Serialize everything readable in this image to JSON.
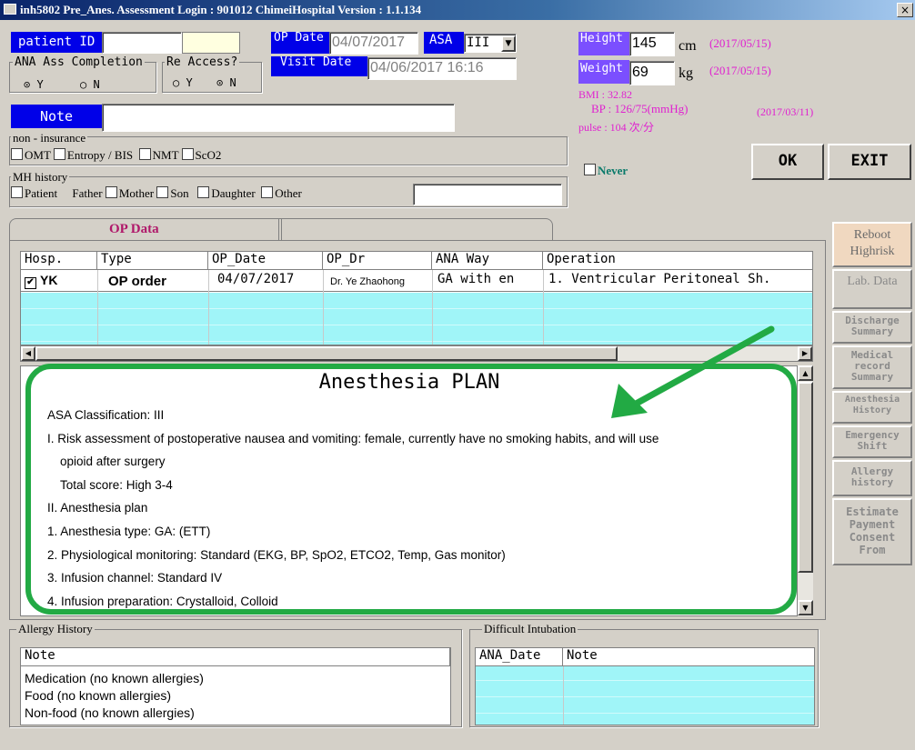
{
  "window": {
    "title": "inh5802 Pre_Anes. Assessment Login  : 901012 ChimeiHospital Version : 1.1.134",
    "close": "×"
  },
  "patient": {
    "id_label": "patient ID",
    "id_value": "",
    "note_label": "Note",
    "note_value": ""
  },
  "op": {
    "op_date_label": "OP Date",
    "op_date": "04/07/2017",
    "asa_label": "ASA",
    "asa_value": "III",
    "visit_date_label": "Visit Date",
    "visit_date": "04/06/2017 16:16"
  },
  "ana_completion": {
    "label": "ANA Ass Completion",
    "options": [
      "Y",
      "N"
    ],
    "selected": "Y"
  },
  "re_access": {
    "label": "Re Access?",
    "options": [
      "Y",
      "N"
    ],
    "selected": "N"
  },
  "vitals": {
    "height_label": "Height",
    "height": "145",
    "height_unit": "cm",
    "height_date": "(2017/05/15)",
    "weight_label": "Weight",
    "weight": "69",
    "weight_unit": "kg",
    "weight_date": "(2017/05/15)",
    "bmi": "BMI : 32.82",
    "bp": "BP : 126/75(mmHg)",
    "bp_date": "(2017/03/11)",
    "pulse": "pulse : 104 次/分"
  },
  "non_insurance": {
    "label": "non - insurance",
    "items": [
      "OMT",
      "Entropy / BIS",
      "NMT",
      "ScO2"
    ]
  },
  "mh_history": {
    "label": "MH history",
    "items": [
      "Patient",
      "Father",
      "Mother",
      "Son",
      "Daughter",
      "Other"
    ]
  },
  "never_label": "Never",
  "buttons": {
    "ok": "OK",
    "exit": "EXIT"
  },
  "tabs": {
    "op_data": "OP Data"
  },
  "op_table": {
    "headers": [
      "Hosp.",
      "Type",
      "OP_Date",
      "OP_Dr",
      "ANA Way",
      "Operation"
    ],
    "row": {
      "hosp": "YK",
      "type": "OP order",
      "date": "04/07/2017",
      "dr": "Dr. Ye Zhaohong",
      "ana": "GA with en",
      "operation": "1. Ventricular Peritoneal Sh."
    }
  },
  "side_buttons": [
    "Reboot Highrisk",
    "Lab. Data",
    "Discharge Summary",
    "Medical record Summary",
    "Anesthesia History",
    "Emergency Shift",
    "Allergy history",
    "Estimate Payment Consent From"
  ],
  "plan": {
    "title": "Anesthesia PLAN",
    "lines": [
      "ASA Classification: III",
      "I. Risk assessment of postoperative nausea and vomiting: female, currently have no smoking habits, and will use",
      "opioid after surgery",
      "Total score: High 3-4",
      "II. Anesthesia plan",
      "1. Anesthesia type: GA: (ETT)",
      "2. Physiological monitoring: Standard (EKG, BP, SpO2, ETCO2, Temp, Gas monitor)",
      "3. Infusion channel: Standard IV",
      "4. Infusion preparation: Crystalloid, Colloid"
    ]
  },
  "allergy": {
    "label": "Allergy History",
    "header": "Note",
    "rows": [
      "Medication (no known allergies)",
      "Food (no known allergies)",
      "Non-food (no known allergies)"
    ]
  },
  "intubation": {
    "label": "Difficult Intubation",
    "headers": [
      "ANA_Date",
      "Note"
    ]
  },
  "colors": {
    "highlight": "#22aa44",
    "cyan": "#a0f5f8",
    "blue_label": "#0000e8",
    "purple_label": "#7b4fff",
    "pink_text": "#e020d0"
  }
}
